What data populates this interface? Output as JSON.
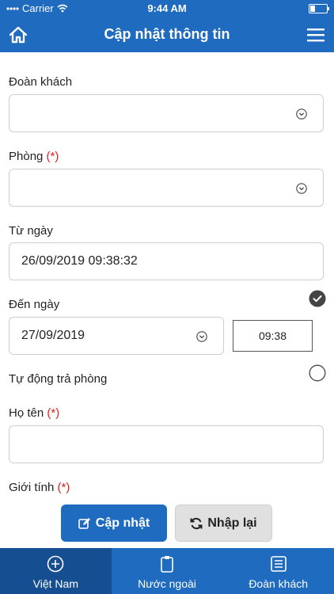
{
  "status_bar": {
    "carrier": "Carrier",
    "time": "9:44 AM"
  },
  "header": {
    "title": "Cập nhật thông tin",
    "left_icon": "home-icon",
    "right_icon": "hamburger-menu-icon"
  },
  "form": {
    "doan_khach": {
      "label": "Đoàn khách",
      "value": ""
    },
    "phong": {
      "label": "Phòng",
      "required_mark": "(*)",
      "value": ""
    },
    "tu_ngay": {
      "label": "Từ ngày",
      "value": "26/09/2019 09:38:32"
    },
    "den_ngay": {
      "label": "Đến ngày",
      "date": "27/09/2019",
      "time": "09:38",
      "checked": true
    },
    "tu_dong_tra_phong": {
      "label": "Tự động trả phòng",
      "checked": false
    },
    "ho_ten": {
      "label": "Họ tên",
      "required_mark": "(*)",
      "value": ""
    },
    "gioi_tinh": {
      "label": "Giới tính",
      "required_mark": "(*)"
    }
  },
  "actions": {
    "update_label": "Cập nhật",
    "reset_label": "Nhập lại"
  },
  "tabs": [
    {
      "label": "Việt Nam",
      "icon": "plus-circle-icon",
      "active": true
    },
    {
      "label": "Nước ngoài",
      "icon": "clipboard-icon",
      "active": false
    },
    {
      "label": "Đoàn khách",
      "icon": "list-icon",
      "active": false
    }
  ],
  "colors": {
    "primary": "#1f6bc0",
    "tab_active": "#154f91",
    "required": "#e02020"
  }
}
